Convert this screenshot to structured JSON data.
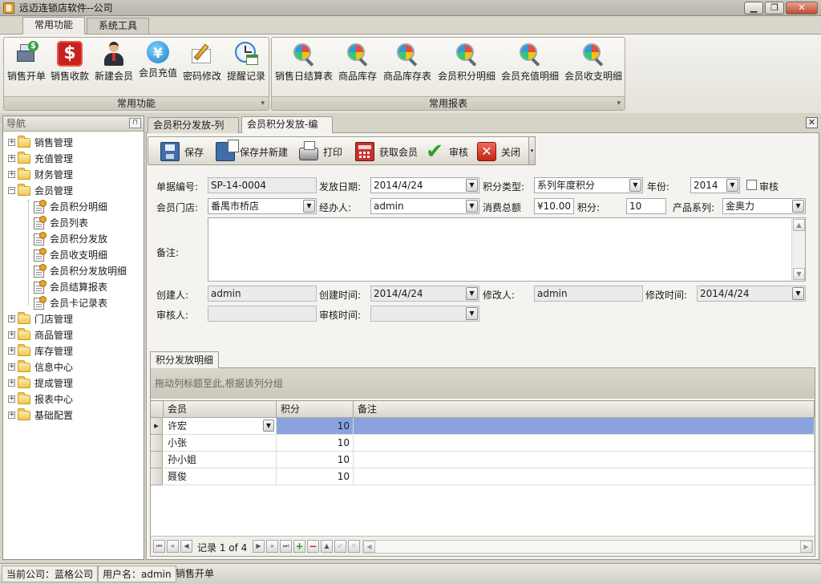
{
  "window": {
    "title": "远迈连锁店软件--公司",
    "minimize": "▁",
    "restore": "❐",
    "close": "✕"
  },
  "ribbon": {
    "tabs": [
      "常用功能",
      "系统工具"
    ],
    "groups": [
      {
        "label": "常用功能",
        "buttons": [
          {
            "label": "销售开单",
            "icon": "cash-register-icon"
          },
          {
            "label": "销售收款",
            "icon": "dollar-icon"
          },
          {
            "label": "新建会员",
            "icon": "user-icon"
          },
          {
            "label": "会员充值",
            "icon": "yen-icon"
          },
          {
            "label": "密码修改",
            "icon": "pencil-icon"
          },
          {
            "label": "提醒记录",
            "icon": "clock-icon"
          }
        ]
      },
      {
        "label": "常用报表",
        "buttons": [
          {
            "label": "销售日结算表",
            "icon": "report-icon"
          },
          {
            "label": "商品库存",
            "icon": "report-icon"
          },
          {
            "label": "商品库存表",
            "icon": "report-icon"
          },
          {
            "label": "会员积分明细",
            "icon": "report-icon"
          },
          {
            "label": "会员充值明细",
            "icon": "report-icon"
          },
          {
            "label": "会员收支明细",
            "icon": "report-icon"
          }
        ]
      }
    ]
  },
  "nav": {
    "title": "导航",
    "items": [
      {
        "label": "销售管理",
        "expanded": false
      },
      {
        "label": "充值管理",
        "expanded": false
      },
      {
        "label": "财务管理",
        "expanded": false
      },
      {
        "label": "会员管理",
        "expanded": true
      },
      {
        "label": "会员积分明细",
        "child": true
      },
      {
        "label": "会员列表",
        "child": true
      },
      {
        "label": "会员积分发放",
        "child": true
      },
      {
        "label": "会员收支明细",
        "child": true
      },
      {
        "label": "会员积分发放明细",
        "child": true
      },
      {
        "label": "会员结算报表",
        "child": true
      },
      {
        "label": "会员卡记录表",
        "child": true
      },
      {
        "label": "门店管理",
        "expanded": false
      },
      {
        "label": "商品管理",
        "expanded": false
      },
      {
        "label": "库存管理",
        "expanded": false
      },
      {
        "label": "信息中心",
        "expanded": false
      },
      {
        "label": "提成管理",
        "expanded": false
      },
      {
        "label": "报表中心",
        "expanded": false
      },
      {
        "label": "基础配置",
        "expanded": false
      }
    ]
  },
  "doc_tabs": [
    "会员积分发放-列表",
    "会员积分发放-编辑"
  ],
  "toolbar": {
    "save": "保存",
    "save_new": "保存并新建",
    "print": "打印",
    "get_member": "获取会员",
    "audit": "审核",
    "close": "关闭"
  },
  "form": {
    "bill_no_label": "单据编号:",
    "bill_no": "SP-14-0004",
    "issue_date_label": "发放日期:",
    "issue_date": "2014/4/24",
    "points_type_label": "积分类型:",
    "points_type": "系列年度积分",
    "year_label": "年份:",
    "year": "2014",
    "audit_label": "审核",
    "store_label": "会员门店:",
    "store": "番禺市桥店",
    "handler_label": "经办人:",
    "handler": "admin",
    "total_spent_label": "消费总额",
    "total_spent": "¥10.00",
    "points_label": "积分:",
    "points": "10",
    "product_series_label": "产品系列:",
    "product_series": "金奥力",
    "remark_label": "备注:",
    "creator_label": "创建人:",
    "creator": "admin",
    "created_label": "创建时间:",
    "created": "2014/4/24",
    "modifier_label": "修改人:",
    "modifier": "admin",
    "modified_label": "修改时间:",
    "modified": "2014/4/24",
    "auditor_label": "审核人:",
    "audit_time_label": "审核时间:"
  },
  "detail": {
    "tab": "积分发放明细",
    "group_hint": "拖动列标题至此,根据该列分组",
    "columns": [
      "会员",
      "积分",
      "备注"
    ],
    "rows": [
      {
        "member": "许宏",
        "points": "10",
        "remark": ""
      },
      {
        "member": "小张",
        "points": "10",
        "remark": ""
      },
      {
        "member": "孙小姐",
        "points": "10",
        "remark": ""
      },
      {
        "member": "聂俊",
        "points": "10",
        "remark": ""
      }
    ],
    "record_text": "记录 1 of 4"
  },
  "status": {
    "company": "当前公司：蓝格公司",
    "user": "用户名：admin",
    "module": "销售开单"
  }
}
